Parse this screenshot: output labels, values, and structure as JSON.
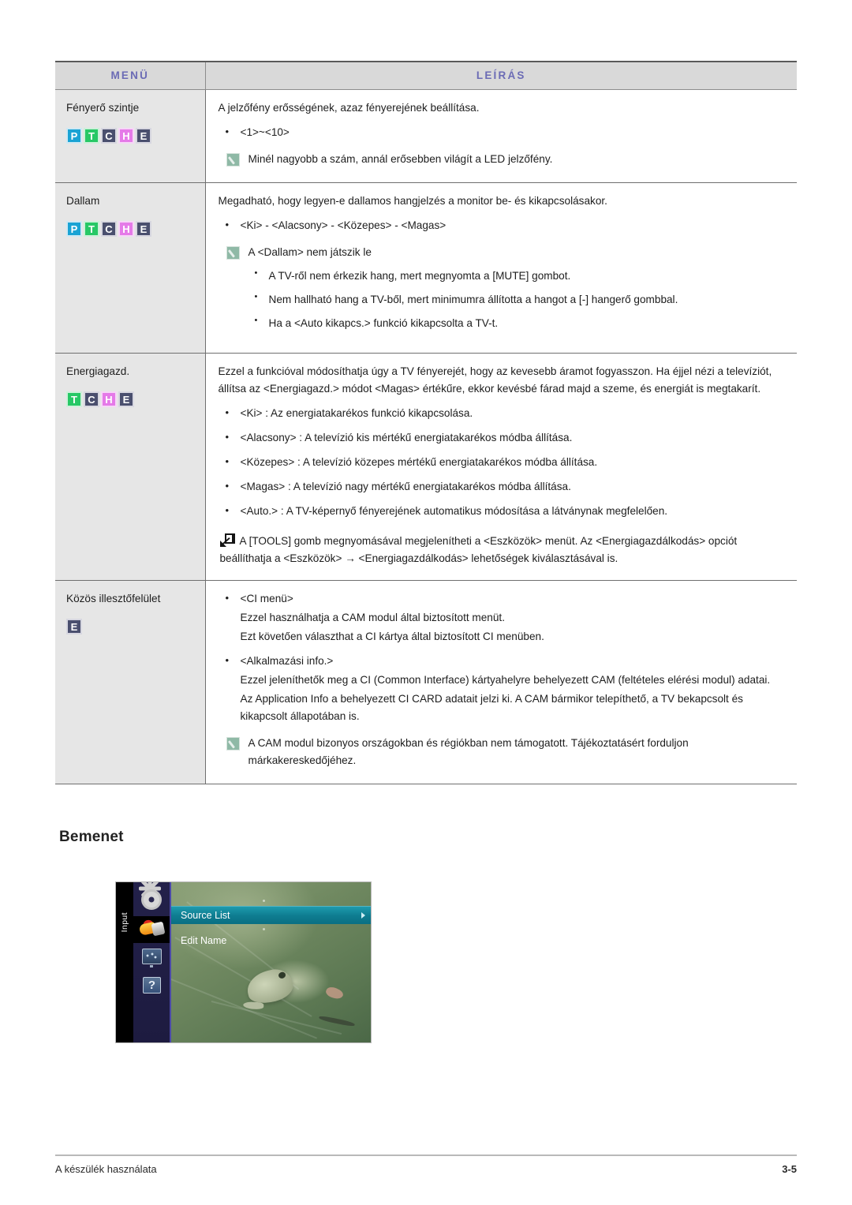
{
  "table": {
    "headers": {
      "menu": "MENÜ",
      "description": "LEÍRÁS"
    },
    "header_color": "#6b6bb5",
    "rows": [
      {
        "menu": "Fényerő szintje",
        "badges": [
          "P",
          "T",
          "C",
          "H",
          "E"
        ],
        "intro": "A jelzőfény erősségének, azaz fényerejének beállítása.",
        "bullets": [
          "<1>~<10>"
        ],
        "note": "Minél nagyobb a szám, annál erősebben világít a LED jelzőfény."
      },
      {
        "menu": "Dallam",
        "badges": [
          "P",
          "T",
          "C",
          "H",
          "E"
        ],
        "intro": "Megadható, hogy legyen-e dallamos hangjelzés a monitor be- és kikapcsolásakor.",
        "bullets": [
          "<Ki> - <Alacsony> - <Közepes> - <Magas>"
        ],
        "note": "A <Dallam> nem játszik le",
        "note_sub": [
          "A TV-ről nem érkezik hang, mert megnyomta a [MUTE] gombot.",
          "Nem hallható hang a TV-ből, mert minimumra állította a hangot a [-] hangerő gombbal.",
          "Ha a <Auto kikapcs.> funkció kikapcsolta a TV-t."
        ]
      },
      {
        "menu": "Energiagazd.",
        "badges": [
          "T",
          "C",
          "H",
          "E"
        ],
        "intro": "Ezzel a funkcióval módosíthatja úgy a TV fényerejét, hogy az kevesebb áramot fogyasszon. Ha éjjel nézi a televíziót, állítsa az <Energiagazd.> módot <Magas> értékűre, ekkor kevésbé fárad majd a szeme, és energiát is megtakarít.",
        "bullets": [
          "<Ki> : Az energiatakarékos funkció kikapcsolása.",
          "<Alacsony> : A televízió kis mértékű energiatakarékos módba állítása.",
          "<Közepes> : A televízió közepes mértékű energiatakarékos módba állítása.",
          "<Magas> : A televízió nagy mértékű energiatakarékos módba állítása.",
          "<Auto.> : A TV-képernyő fényerejének automatikus módosítása a látványnak megfelelően."
        ],
        "tools_note": "A [TOOLS] gomb megnyomásával megjelenítheti a <Eszközök> menüt. Az <Energiagazdálkodás> opciót beállíthatja a <Eszközök> → <Energiagazdálkodás> lehetőségek kiválasztásával is."
      },
      {
        "menu": "Közös illesztőfelület",
        "badges": [
          "E"
        ],
        "ci_bullets": [
          {
            "label": "<CI menü>",
            "lines": [
              "Ezzel használhatja a CAM modul által biztosított menüt.",
              "Ezt követően választhat a CI kártya által biztosított CI menüben."
            ]
          },
          {
            "label": "<Alkalmazási info.>",
            "lines": [
              "Ezzel jeleníthetők meg a CI (Common Interface) kártyahelyre behelyezett CAM (feltételes elérési modul) adatai.",
              "Az Application Info a behelyezett CI CARD adatait jelzi ki. A CAM bármikor telepíthető, a TV bekapcsolt és kikapcsolt állapotában is."
            ]
          }
        ],
        "note": "A CAM modul bizonyos országokban és régiókban nem támogatott. Tájékoztatásért forduljon márkakereskedőjéhez."
      }
    ]
  },
  "section": {
    "heading": "Bemenet"
  },
  "osd": {
    "tab_label": "Input",
    "icons": [
      "gear-icon",
      "input-plug-icon",
      "picture-icon",
      "help-icon"
    ],
    "help_glyph": "?",
    "menu_items": [
      {
        "label": "Source List",
        "selected": true
      },
      {
        "label": "Edit Name",
        "selected": false
      }
    ],
    "highlight_color": "#0e7c90"
  },
  "footer": {
    "left": "A készülék használata",
    "page": "3-5"
  },
  "badge_colors": {
    "P": "#1aa3d4",
    "T": "#27c866",
    "C": "#4a4f6e",
    "H": "#e57ae8",
    "E": "#4a4f6e"
  }
}
